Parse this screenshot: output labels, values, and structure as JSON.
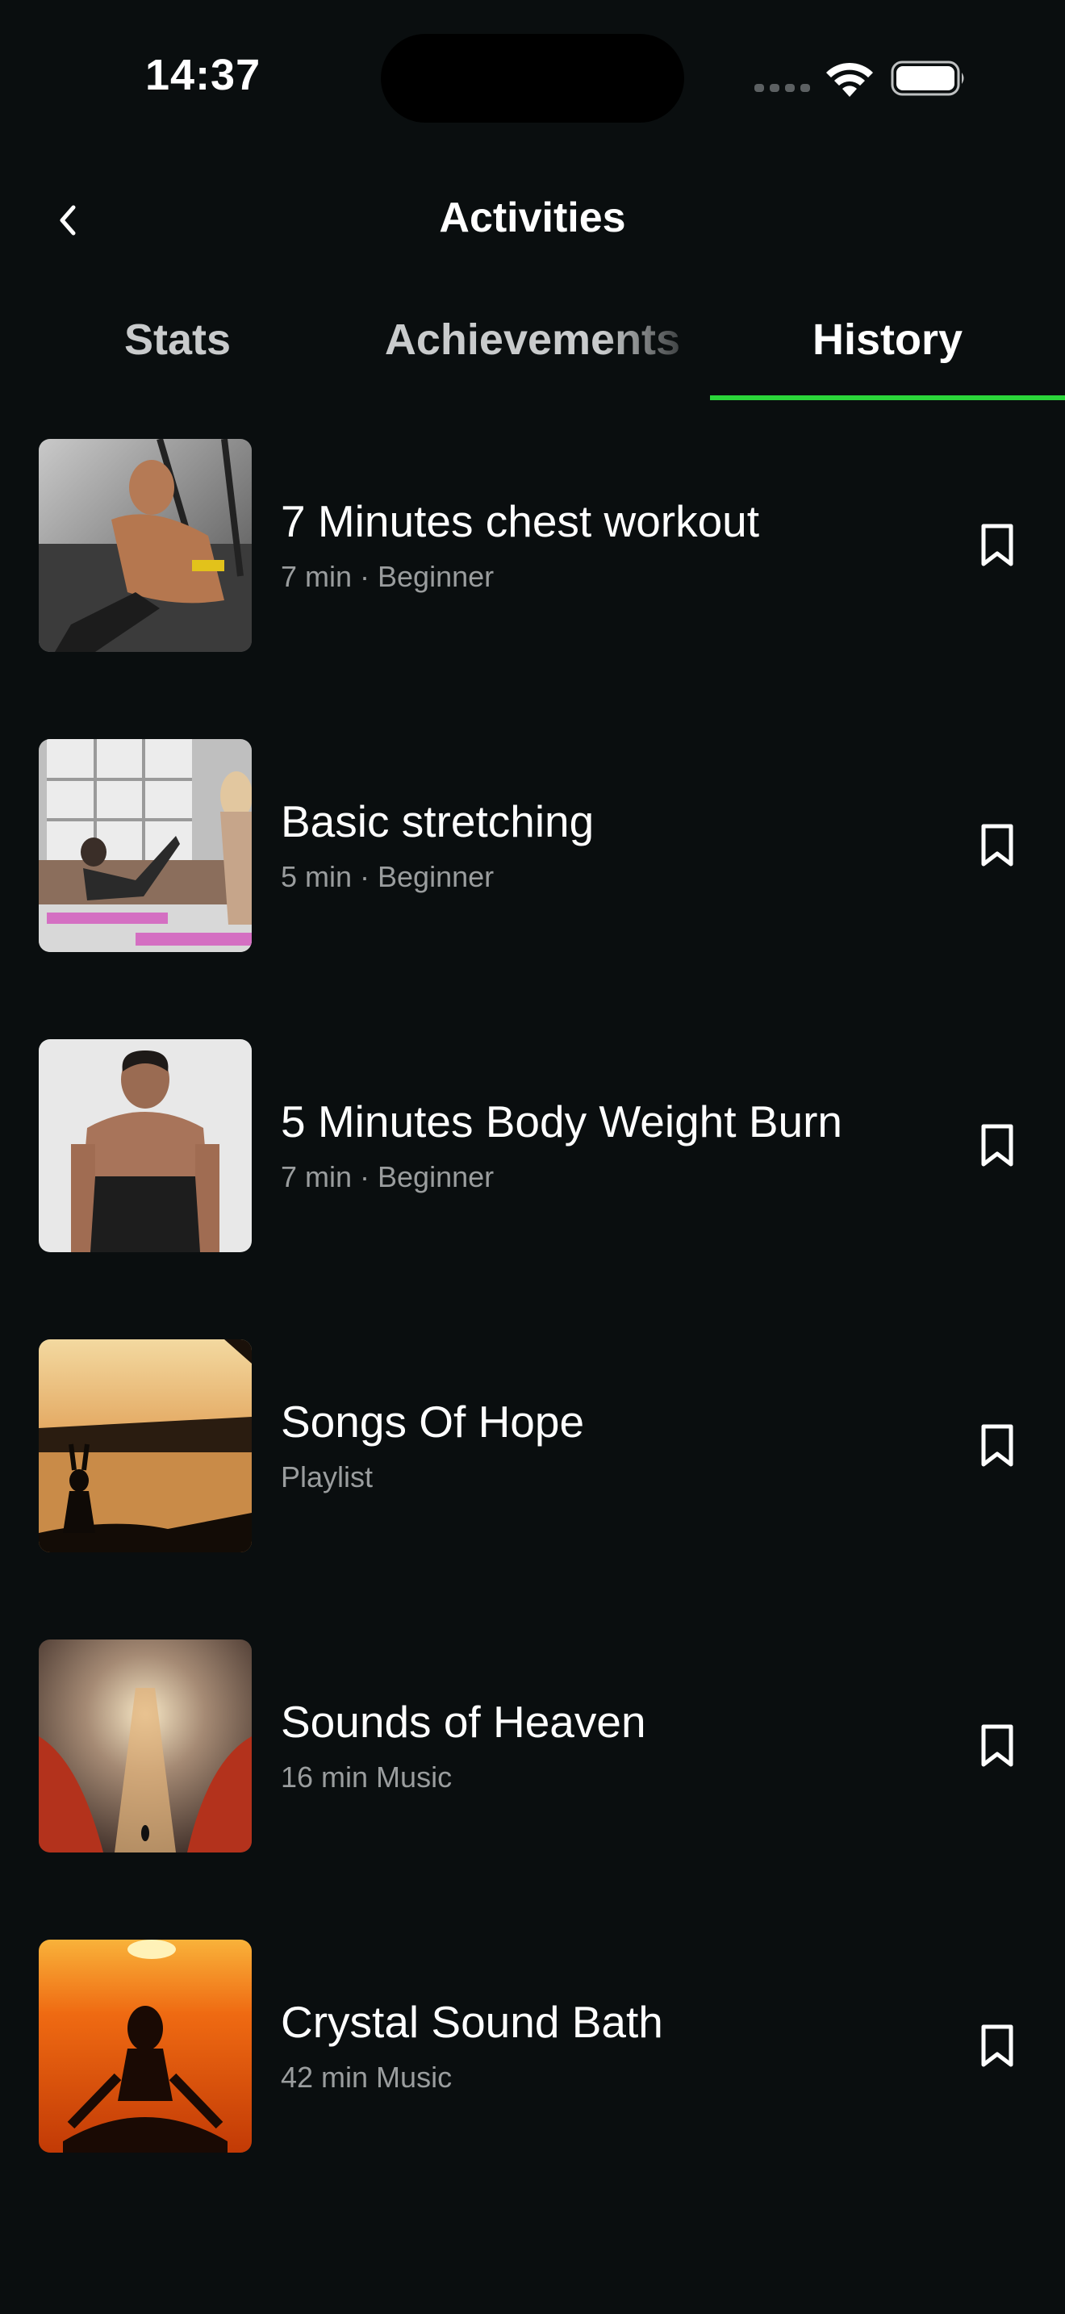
{
  "status_bar": {
    "time": "14:37"
  },
  "header": {
    "title": "Activities"
  },
  "tabs": [
    {
      "label": "Stats",
      "active": false
    },
    {
      "label": "Achievements",
      "active": false
    },
    {
      "label": "History",
      "active": true
    }
  ],
  "accent_color": "#2bd63a",
  "history": [
    {
      "title": "7 Minutes chest workout",
      "subtitle": "7 min · Beginner",
      "icon": "bookmark-icon"
    },
    {
      "title": "Basic stretching",
      "subtitle": "5 min · Beginner",
      "icon": "bookmark-icon"
    },
    {
      "title": "5 Minutes Body Weight Burn",
      "subtitle": "7 min · Beginner",
      "icon": "bookmark-icon"
    },
    {
      "title": "Songs Of Hope",
      "subtitle": "Playlist",
      "icon": "bookmark-icon"
    },
    {
      "title": "Sounds of Heaven",
      "subtitle": "16 min Music",
      "icon": "bookmark-icon"
    },
    {
      "title": "Crystal Sound Bath",
      "subtitle": "42 min Music",
      "icon": "bookmark-icon"
    }
  ]
}
